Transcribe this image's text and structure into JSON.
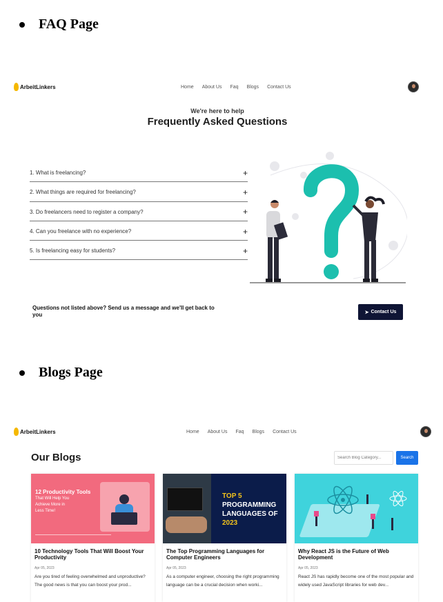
{
  "sections": {
    "faq_heading": "FAQ Page",
    "blogs_heading": "Blogs Page"
  },
  "brand": {
    "name": "ArbeitLinkers",
    "color": "#f5b800"
  },
  "nav": {
    "links": [
      "Home",
      "About Us",
      "Faq",
      "Blogs",
      "Contact Us"
    ]
  },
  "faq": {
    "subtitle": "We're here to help",
    "title": "Frequently Asked Questions",
    "items": [
      "1. What is freelancing?",
      "2. What things are required for freelancing?",
      "3. Do freelancers need to register a company?",
      "4. Can you freelance with no experience?",
      "5. Is freelancing easy for students?"
    ],
    "toggle_icon": "+",
    "cta_text": "Questions not listed above? Send us a message and we'll get back to you",
    "cta_button": "Contact Us",
    "cta_color": "#0f1535",
    "illustration_accent": "#1cbfae"
  },
  "blogs": {
    "title": "Our Blogs",
    "search_placeholder": "Search Blog Category...",
    "search_button": "Search",
    "search_color": "#1a73e8",
    "cards": [
      {
        "image_headline": [
          "12 Productivity Tools",
          "That Will Help You",
          "Achieve More in",
          "Less Time!"
        ],
        "title": "10 Technology Tools That Will Boost Your Productivity",
        "date": "Apr 05, 2023",
        "excerpt": "Are you tired of feeling overwhelmed and unproductive? The good news is that you can boost your prod..."
      },
      {
        "image_headline": [
          "TOP 5",
          "PROGRAMMING",
          "LANGUAGES OF",
          "2023"
        ],
        "title": "The Top Programming Languages for Computer Engineers",
        "date": "Apr 05, 2023",
        "excerpt": "As a computer engineer, choosing the right programming language can be a crucial decision when worki..."
      },
      {
        "image_headline": [],
        "title": "Why React JS is the Future of Web Development",
        "date": "Apr 05, 2023",
        "excerpt": "React JS has rapidly become one of the most popular and widely used JavaScript libraries for web dev..."
      }
    ]
  }
}
